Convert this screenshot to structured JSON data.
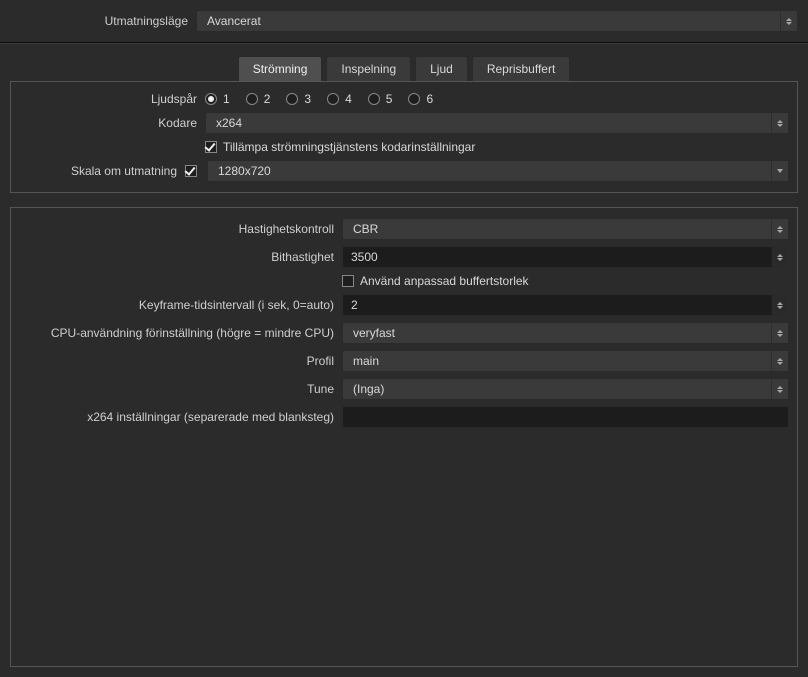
{
  "output_mode": {
    "label": "Utmatningsläge",
    "value": "Avancerat"
  },
  "tabs": [
    {
      "label": "Strömning",
      "active": true
    },
    {
      "label": "Inspelning",
      "active": false
    },
    {
      "label": "Ljud",
      "active": false
    },
    {
      "label": "Reprisbuffert",
      "active": false
    }
  ],
  "streaming": {
    "audio_tracks_label": "Ljudspår",
    "audio_tracks": [
      "1",
      "2",
      "3",
      "4",
      "5",
      "6"
    ],
    "audio_track_selected": "1",
    "encoder_label": "Kodare",
    "encoder_value": "x264",
    "enforce_label": "Tillämpa strömningstjänstens kodarinställningar",
    "enforce_checked": true,
    "rescale_label": "Skala om utmatning",
    "rescale_checked": true,
    "rescale_value": "1280x720"
  },
  "encoder_settings": {
    "rate_control_label": "Hastighetskontroll",
    "rate_control_value": "CBR",
    "bitrate_label": "Bithastighet",
    "bitrate_value": "3500",
    "custom_buffer_label": "Använd anpassad buffertstorlek",
    "custom_buffer_checked": false,
    "keyframe_label": "Keyframe-tidsintervall (i sek, 0=auto)",
    "keyframe_value": "2",
    "cpu_preset_label": "CPU-användning förinställning (högre = mindre CPU)",
    "cpu_preset_value": "veryfast",
    "profile_label": "Profil",
    "profile_value": "main",
    "tune_label": "Tune",
    "tune_value": "(Inga)",
    "x264opts_label": "x264 inställningar (separerade med blanksteg)",
    "x264opts_value": ""
  }
}
